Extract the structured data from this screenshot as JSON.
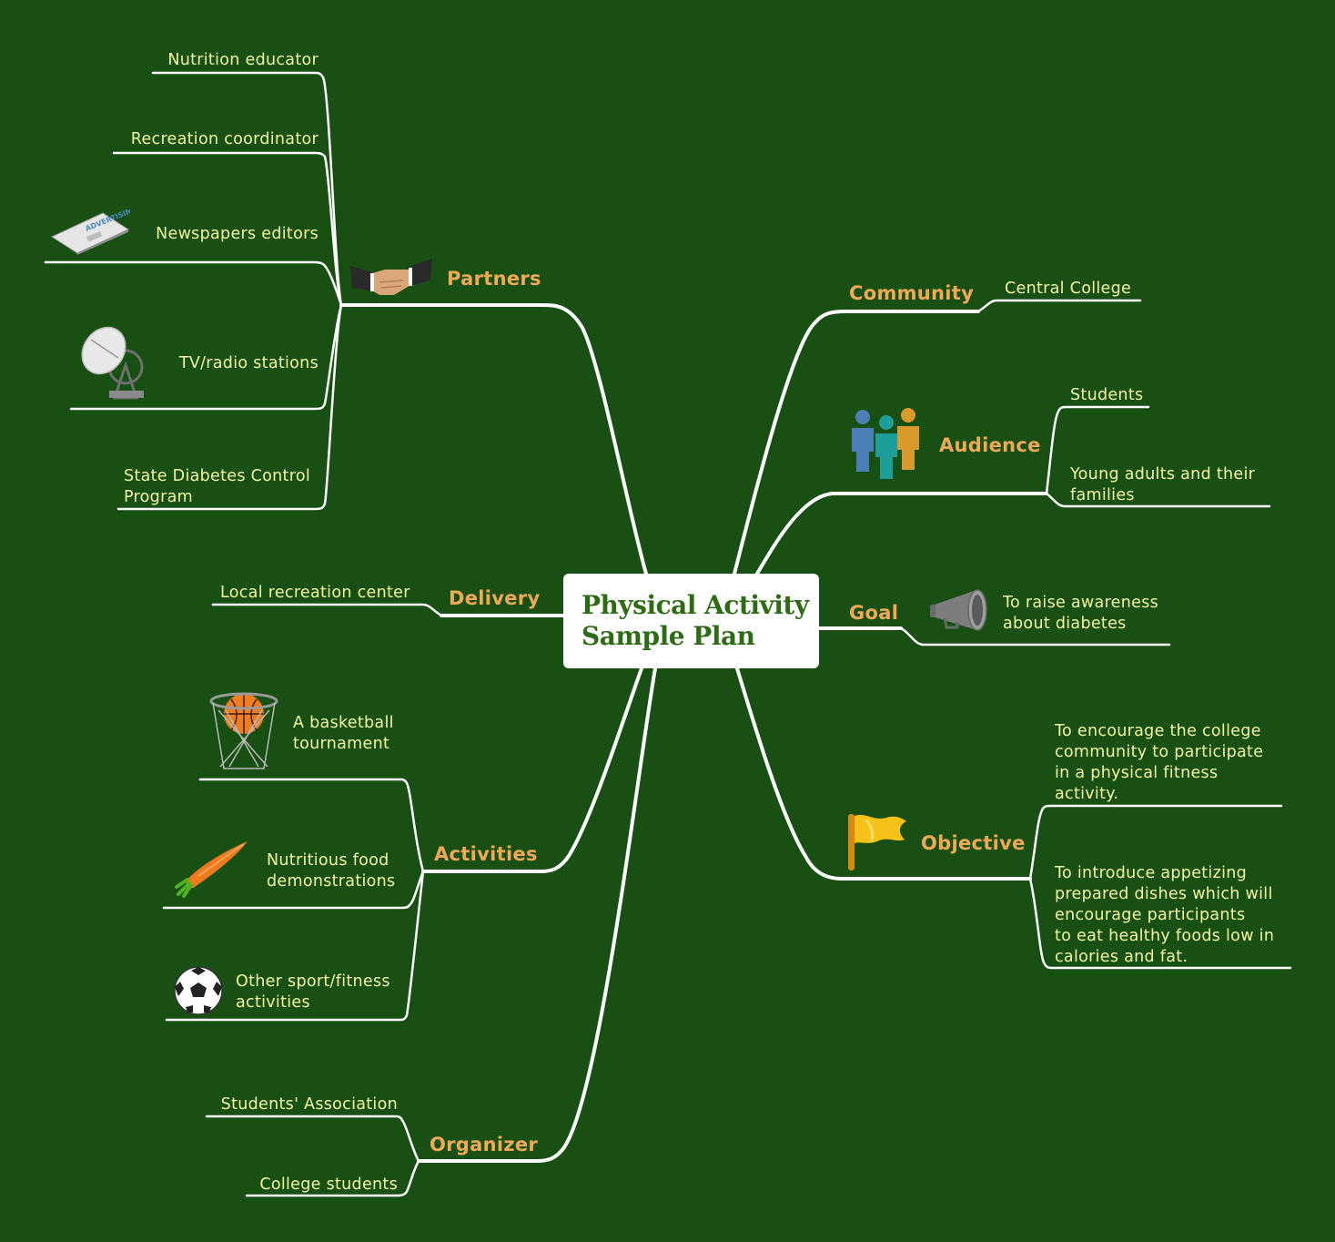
{
  "title": {
    "line1": "Physical Activity",
    "line2": "Sample Plan"
  },
  "colors": {
    "background": "#175012",
    "topic_text": "#f2a955",
    "subtopic_text": "#f4f6a0",
    "connector": "#ffffff",
    "title_text": "#2d6b14",
    "title_box": "#ffffff"
  },
  "branches": {
    "partners": {
      "label": "Partners",
      "icon": "handshake-icon",
      "items": [
        {
          "label": "Nutrition educator"
        },
        {
          "label": "Recreation coordinator"
        },
        {
          "label": "Newspapers editors",
          "icon": "newspaper-icon"
        },
        {
          "label": "TV/radio stations",
          "icon": "satellite-dish-icon"
        },
        {
          "label": "State Diabetes Control",
          "label2": "Program"
        }
      ]
    },
    "delivery": {
      "label": "Delivery",
      "items": [
        {
          "label": "Local recreation center"
        }
      ]
    },
    "activities": {
      "label": "Activities",
      "items": [
        {
          "label": "A basketball",
          "label2": "tournament",
          "icon": "basketball-hoop-icon"
        },
        {
          "label": "Nutritious food",
          "label2": "demonstrations",
          "icon": "carrot-icon"
        },
        {
          "label": "Other sport/fitness",
          "label2": "activities",
          "icon": "soccer-ball-icon"
        }
      ]
    },
    "organizer": {
      "label": "Organizer",
      "items": [
        {
          "label": "Students' Association"
        },
        {
          "label": "College students"
        }
      ]
    },
    "community": {
      "label": "Community",
      "items": [
        {
          "label": "Central College"
        }
      ]
    },
    "audience": {
      "label": "Audience",
      "icon": "people-group-icon",
      "items": [
        {
          "label": "Students"
        },
        {
          "label": "Young adults and their",
          "label2": "families"
        }
      ]
    },
    "goal": {
      "label": "Goal",
      "icon": "megaphone-icon",
      "items": [
        {
          "label": "To raise awareness",
          "label2": "about diabetes"
        }
      ]
    },
    "objective": {
      "label": "Objective",
      "icon": "flag-icon",
      "items": [
        {
          "lines": [
            "To encourage the college",
            "community to participate",
            "in a physical fitness",
            "activity."
          ]
        },
        {
          "lines": [
            "To introduce appetizing",
            "prepared dishes which will",
            "encourage participants",
            "to eat healthy foods low in",
            "calories and fat."
          ]
        }
      ]
    }
  }
}
